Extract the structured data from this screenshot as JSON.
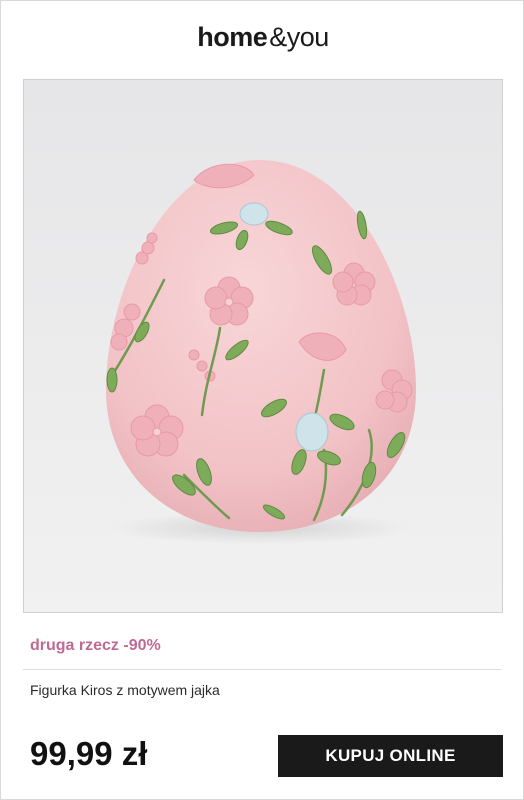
{
  "header": {
    "logo_bold": "home",
    "logo_light": "&you"
  },
  "product": {
    "image_alt": "Figurka Kiros z motywem jajka",
    "promo": "druga rzecz -90%",
    "name": "Figurka Kiros z motywem jajka",
    "price": "99,99 zł",
    "buy_label": "KUPUJ ONLINE"
  },
  "colors": {
    "promo": "#c06a93",
    "button": "#1a1a1a",
    "egg": "#f3c7cb"
  }
}
